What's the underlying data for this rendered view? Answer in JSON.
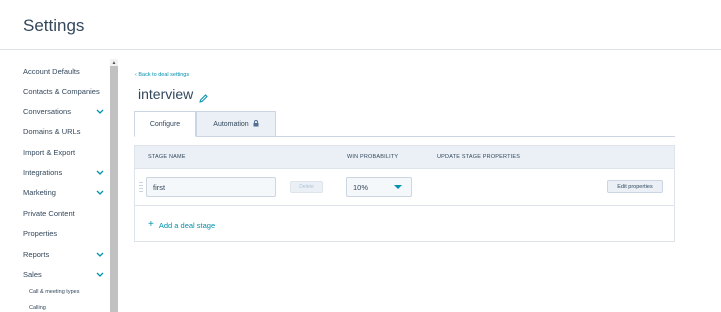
{
  "header": {
    "title": "Settings"
  },
  "sidebar": {
    "items": [
      {
        "label": "Account Defaults",
        "expandable": false
      },
      {
        "label": "Contacts & Companies",
        "expandable": false
      },
      {
        "label": "Conversations",
        "expandable": true
      },
      {
        "label": "Domains & URLs",
        "expandable": false
      },
      {
        "label": "Import & Export",
        "expandable": false
      },
      {
        "label": "Integrations",
        "expandable": true
      },
      {
        "label": "Marketing",
        "expandable": true
      },
      {
        "label": "Private Content",
        "expandable": false
      },
      {
        "label": "Properties",
        "expandable": false
      },
      {
        "label": "Reports",
        "expandable": true
      },
      {
        "label": "Sales",
        "expandable": true
      }
    ],
    "sub_items": [
      "Call & meeting types",
      "Calling"
    ]
  },
  "main": {
    "back_link": "‹ Back to deal settings",
    "pipeline_name": "interview",
    "tabs": [
      {
        "label": "Configure",
        "active": true
      },
      {
        "label": "Automation",
        "active": false,
        "icon": "lock-icon"
      }
    ],
    "table": {
      "headers": [
        "STAGE NAME",
        "WIN PROBABILITY",
        "UPDATE STAGE PROPERTIES"
      ],
      "rows": [
        {
          "stage_name": "first",
          "delete_label": "Delete",
          "probability": "10%",
          "edit_label": "Edit properties"
        }
      ]
    },
    "add_stage_label": "Add a deal stage"
  },
  "colors": {
    "accent": "#0091ae",
    "text": "#33475b",
    "header_bg": "#eaf0f6",
    "border": "#cbd6e2"
  }
}
